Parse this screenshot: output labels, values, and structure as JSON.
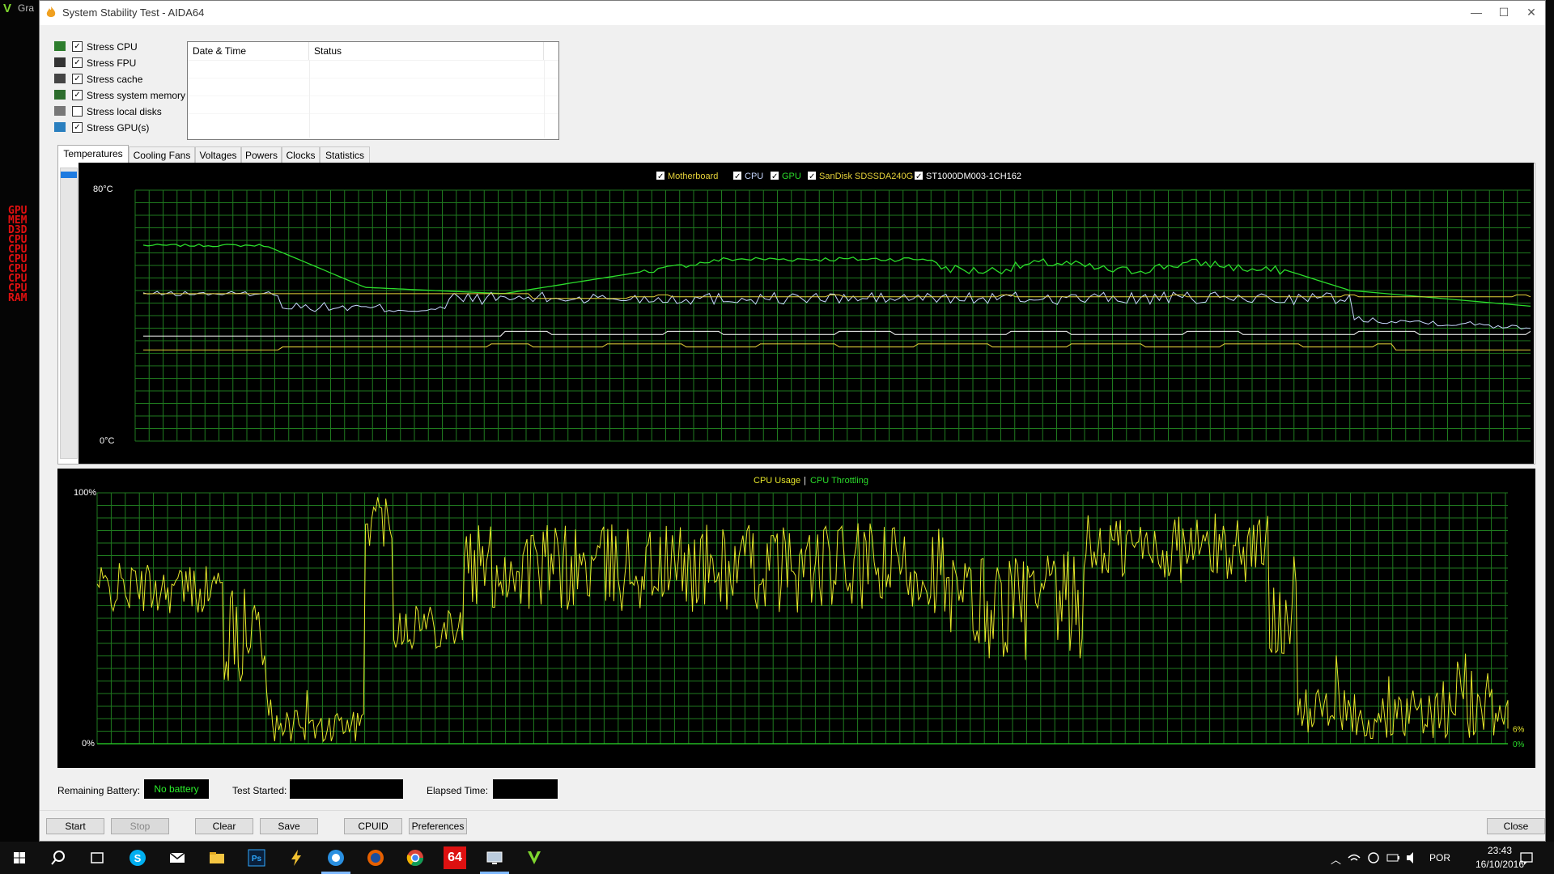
{
  "background": {
    "partial_title": "Gra",
    "osd_lines": [
      "GPU",
      "MEM",
      "D3D",
      "CPU",
      "CPU",
      "CPU",
      "CPU",
      "CPU",
      "CPU",
      "RAM"
    ]
  },
  "window": {
    "title": "System Stability Test - AIDA64",
    "controls": {
      "minimize": "—",
      "maximize": "☐",
      "close": "✕"
    }
  },
  "stress_options": [
    {
      "label": "Stress CPU",
      "checked": true,
      "icon": "cpu-icon"
    },
    {
      "label": "Stress FPU",
      "checked": true,
      "icon": "fpu-icon"
    },
    {
      "label": "Stress cache",
      "checked": true,
      "icon": "cache-icon"
    },
    {
      "label": "Stress system memory",
      "checked": true,
      "icon": "memory-icon"
    },
    {
      "label": "Stress local disks",
      "checked": false,
      "icon": "disk-icon"
    },
    {
      "label": "Stress GPU(s)",
      "checked": true,
      "icon": "gpu-icon"
    }
  ],
  "log": {
    "columns": [
      "Date & Time",
      "Status"
    ]
  },
  "tabs": [
    "Temperatures",
    "Cooling Fans",
    "Voltages",
    "Powers",
    "Clocks",
    "Statistics"
  ],
  "active_tab": "Temperatures",
  "temp_graph": {
    "y_max_label": "80°C",
    "y_min_label": "0°C",
    "legend": [
      {
        "label": "Motherboard",
        "color": "#e6d23a",
        "checked": true
      },
      {
        "label": "CPU",
        "color": "#c8d8ff",
        "checked": true
      },
      {
        "label": "GPU",
        "color": "#2bdc2b",
        "checked": true
      },
      {
        "label": "SanDisk SDSSDA240G",
        "color": "#e6d23a",
        "checked": true
      },
      {
        "label": "ST1000DM003-1CH162",
        "color": "#ffffff",
        "checked": true
      }
    ],
    "end_labels": [
      {
        "text": "46",
        "color": "#e6d23a"
      },
      {
        "text": "43",
        "color": "#2bdc2b"
      },
      {
        "text": "34",
        "color": "#ffffff"
      },
      {
        "text": "35",
        "color": "#c8d8ff"
      },
      {
        "text": "29",
        "color": "#e6d23a"
      }
    ]
  },
  "cpu_graph": {
    "y_max_label": "100%",
    "y_min_label": "0%",
    "legend_usage": "CPU Usage",
    "legend_separator": "|",
    "legend_throttling": "CPU Throttling",
    "usage_end_label": "6%",
    "throttling_end_label": "0%"
  },
  "status_bar": {
    "battery_label": "Remaining Battery:",
    "battery_value": "No battery",
    "test_started_label": "Test Started:",
    "test_started_value": "",
    "elapsed_label": "Elapsed Time:",
    "elapsed_value": ""
  },
  "buttons": {
    "start": "Start",
    "stop": "Stop",
    "clear": "Clear",
    "save": "Save",
    "cpuid": "CPUID",
    "preferences": "Preferences",
    "close": "Close"
  },
  "taskbar": {
    "language": "POR",
    "time": "23:43",
    "date": "16/10/2016",
    "aida_badge": "64"
  },
  "colors": {
    "grid": "#1f7a1f",
    "cpu_usage": "#e6e62a",
    "cpu_throttling": "#2bdc2b",
    "battery_text": "#2bf02b"
  }
}
